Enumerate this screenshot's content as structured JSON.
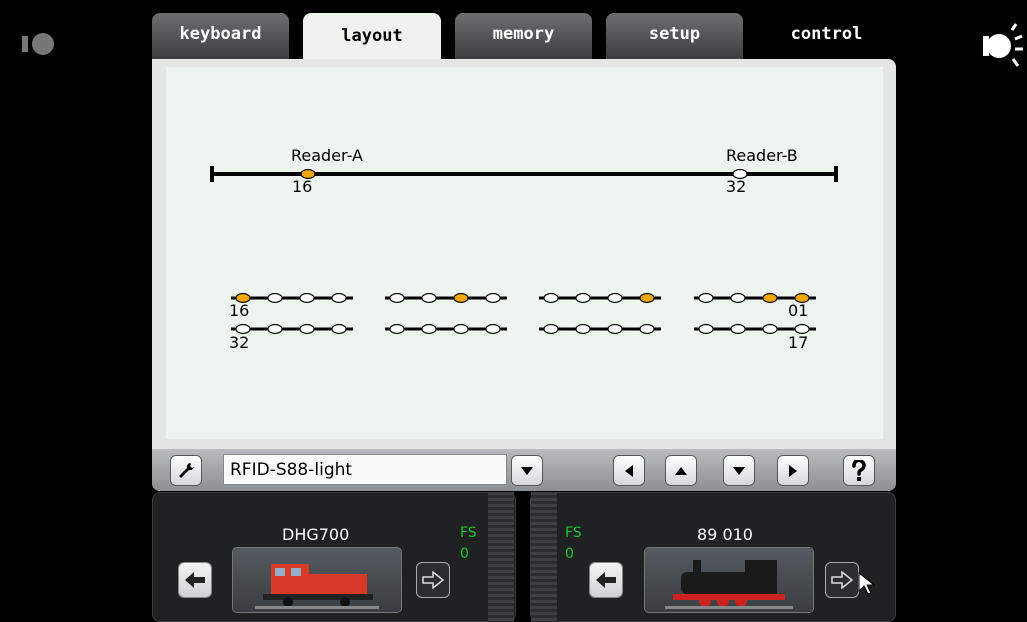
{
  "tabs": [
    {
      "label": "keyboard",
      "active": false
    },
    {
      "label": "layout",
      "active": true
    },
    {
      "label": "memory",
      "active": false
    },
    {
      "label": "setup",
      "active": false
    },
    {
      "label": "control",
      "active": false
    }
  ],
  "track": {
    "reader_a_label": "Reader-A",
    "reader_a_number": "16",
    "reader_b_label": "Reader-B",
    "reader_b_number": "32"
  },
  "contact_grid": {
    "label_top_left": "16",
    "label_bottom_left": "32",
    "label_top_right": "01",
    "label_bottom_right": "17",
    "active_color": "#f0a800",
    "inactive_color": "#ffffff"
  },
  "toolbar": {
    "selected_device": "RFID-S88-light"
  },
  "locos": [
    {
      "name": "DHG700",
      "fs_label": "FS",
      "fs_value": "0"
    },
    {
      "name": "89 010",
      "fs_label": "FS",
      "fs_value": "0"
    }
  ],
  "icons": {
    "left_top": "stop-light-icon",
    "right_top": "light-bulb-icon"
  }
}
